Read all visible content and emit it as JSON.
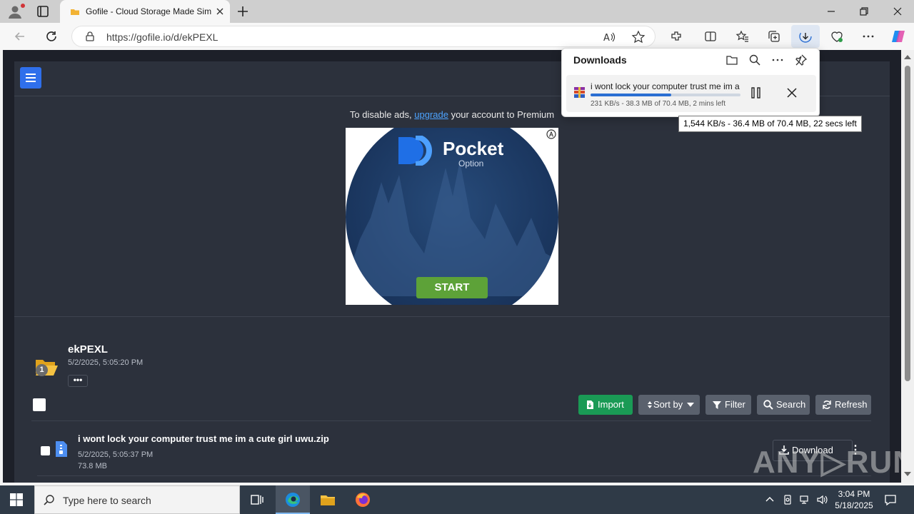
{
  "browser": {
    "tab_title": "Gofile - Cloud Storage Made Simple",
    "url": "https://gofile.io/d/ekPEXL"
  },
  "page": {
    "ads_prefix": "To disable ads, ",
    "ads_link": "upgrade",
    "ads_suffix": " your account to Premium",
    "ad": {
      "brand": "Pocket",
      "sub": "Option",
      "cta": "START"
    },
    "folder": {
      "name": "ekPEXL",
      "date": "5/2/2025, 5:05:20 PM",
      "count": "1",
      "more": "•••"
    },
    "toolbar": {
      "import": "Import",
      "sort": "Sort by",
      "filter": "Filter",
      "search": "Search",
      "refresh": "Refresh"
    },
    "file": {
      "name": "i wont lock your computer trust me im a cute girl uwu.zip",
      "date": "5/2/2025, 5:05:37 PM",
      "size": "73.8 MB",
      "download": "Download"
    },
    "watermark": "ANY▷RUN"
  },
  "downloads": {
    "heading": "Downloads",
    "item_name": "i wont lock your computer trust me im a cute girl uwu.zip",
    "item_status": "231 KB/s - 38.3 MB of 70.4 MB, 2 mins left",
    "progress": 0.54,
    "tooltip": "1,544 KB/s - 36.4 MB of 70.4 MB, 22 secs left"
  },
  "taskbar": {
    "search_placeholder": "Type here to search",
    "time": "3:04 PM",
    "date": "5/18/2025"
  },
  "colors": {
    "accent": "#2f6feb",
    "import_green": "#1a9a55",
    "progress_blue": "#2b6fd3"
  }
}
